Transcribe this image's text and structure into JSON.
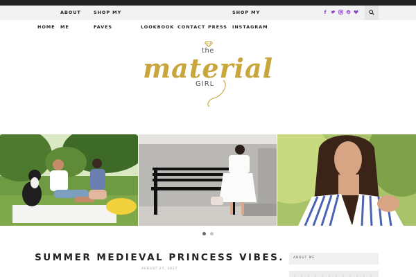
{
  "nav": {
    "items": [
      {
        "label": "HOME"
      },
      {
        "label": "ABOUT"
      },
      {
        "label": "ME"
      },
      {
        "label": "SHOP MY"
      },
      {
        "label": "FAVES"
      },
      {
        "label": "LOOKBOOK"
      },
      {
        "label": "CONTACT"
      },
      {
        "label": "PRESS"
      },
      {
        "label": "SHOP MY"
      },
      {
        "label": "INSTAGRAM"
      }
    ],
    "social_icons": [
      "facebook-icon",
      "twitter-icon",
      "instagram-icon",
      "pinterest-icon",
      "heart-icon"
    ],
    "accent_color": "#8c49c2",
    "search_icon": "search-icon"
  },
  "logo": {
    "the": "the",
    "main": "material",
    "girl": "GIRL",
    "gold_color": "#c9a63c"
  },
  "slider": {
    "slides": [
      {
        "alt": "couple with dog on picnic blanket"
      },
      {
        "alt": "woman in white dress on black bench"
      },
      {
        "alt": "woman in striped shirt smiling"
      }
    ],
    "dots": [
      {
        "active": true
      },
      {
        "active": false
      }
    ]
  },
  "post": {
    "title": "SUMMER MEDIEVAL PRINCESS VIBES.",
    "date": "AUGUST 27, 2017"
  },
  "sidebar": {
    "widget_title": "ABOUT ME"
  }
}
